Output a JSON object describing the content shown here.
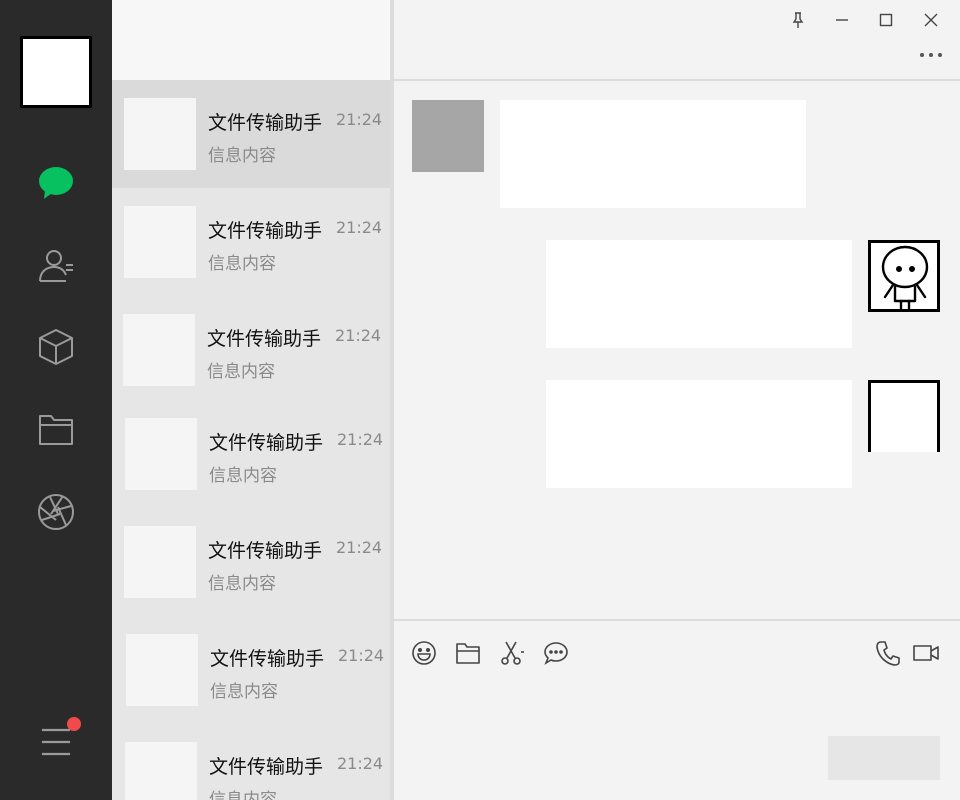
{
  "sessions": [
    {
      "name": "文件传输助手",
      "time": "21:24",
      "preview": "信息内容"
    },
    {
      "name": "文件传输助手",
      "time": "21:24",
      "preview": "信息内容"
    },
    {
      "name": "文件传输助手",
      "time": "21:24",
      "preview": "信息内容"
    },
    {
      "name": "文件传输助手",
      "time": "21:24",
      "preview": "信息内容"
    },
    {
      "name": "文件传输助手",
      "time": "21:24",
      "preview": "信息内容"
    },
    {
      "name": "文件传输助手",
      "time": "21:24",
      "preview": "信息内容"
    },
    {
      "name": "文件传输助手",
      "time": "21:24",
      "preview": "信息内容"
    }
  ],
  "nav": {
    "items": [
      "chat-icon",
      "contacts-icon",
      "favorites-box-icon",
      "folder-icon",
      "moments-aperture-icon"
    ],
    "menu_icon": "menu-icon",
    "unread_badge_color": "#f24a4a",
    "active_color": "#07c160"
  },
  "titlebar": {
    "icons": [
      "pin-icon",
      "minimize-icon",
      "maximize-icon",
      "close-icon",
      "more-icon"
    ]
  },
  "composer": {
    "left_icons": [
      "emoji-icon",
      "file-icon",
      "screenshot-scissors-icon",
      "chat-history-icon"
    ],
    "right_icons": [
      "voice-call-icon",
      "video-call-icon"
    ]
  }
}
